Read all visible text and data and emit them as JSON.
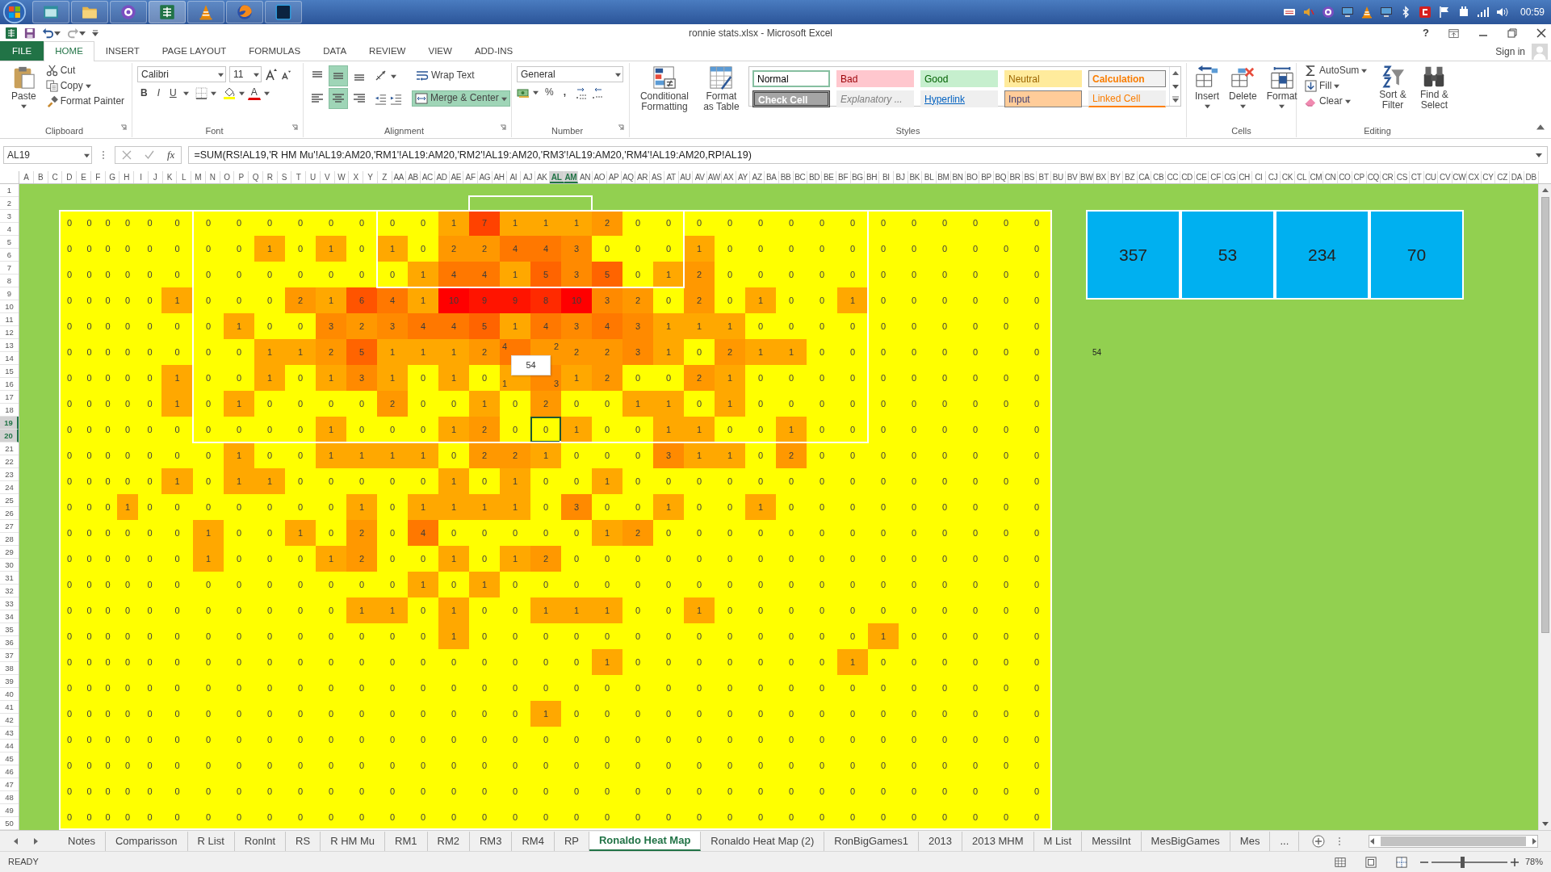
{
  "taskbar": {
    "clock": "00:59"
  },
  "window": {
    "title": "ronnie stats.xlsx - Microsoft Excel",
    "help": "?",
    "sign_in": "Sign in"
  },
  "ribbon_tabs": [
    {
      "label": "FILE",
      "kind": "file",
      "selected": false
    },
    {
      "label": "HOME",
      "kind": "tab",
      "selected": true
    },
    {
      "label": "INSERT",
      "kind": "tab",
      "selected": false
    },
    {
      "label": "PAGE LAYOUT",
      "kind": "tab",
      "selected": false
    },
    {
      "label": "FORMULAS",
      "kind": "tab",
      "selected": false
    },
    {
      "label": "DATA",
      "kind": "tab",
      "selected": false
    },
    {
      "label": "REVIEW",
      "kind": "tab",
      "selected": false
    },
    {
      "label": "VIEW",
      "kind": "tab",
      "selected": false
    },
    {
      "label": "ADD-INS",
      "kind": "tab",
      "selected": false
    }
  ],
  "clipboard": {
    "paste": "Paste",
    "cut": "Cut",
    "copy": "Copy",
    "format_painter": "Format Painter",
    "label": "Clipboard"
  },
  "font": {
    "name": "Calibri",
    "size": "11",
    "bold": "B",
    "italic": "I",
    "underline": "U",
    "font_color": "A",
    "label": "Font"
  },
  "alignment": {
    "align_buttons": [
      {
        "on": false
      },
      {
        "on": true
      },
      {
        "on": false
      },
      {
        "on": false
      },
      {
        "on": true
      },
      {
        "on": false
      }
    ],
    "wrap_text": "Wrap Text",
    "merge_center": {
      "label": "Merge & Center",
      "on": true
    },
    "label": "Alignment"
  },
  "number": {
    "format": "General",
    "percent": "%",
    "comma": ",",
    "label": "Number"
  },
  "styles": {
    "conditional": "Conditional Formatting",
    "format_table": "Format as Table",
    "gallery": [
      {
        "label": "Normal",
        "kind": "normal"
      },
      {
        "label": "Bad",
        "kind": "bad"
      },
      {
        "label": "Good",
        "kind": "good"
      },
      {
        "label": "Neutral",
        "kind": "neutral"
      },
      {
        "label": "Calculation",
        "kind": "calculation"
      },
      {
        "label": "Check Cell",
        "kind": "check"
      },
      {
        "label": "Explanatory ...",
        "kind": "explanatory"
      },
      {
        "label": "Hyperlink",
        "kind": "hyperlink"
      },
      {
        "label": "Input",
        "kind": "input"
      },
      {
        "label": "Linked Cell",
        "kind": "linked"
      }
    ],
    "label": "Styles"
  },
  "cells": {
    "insert": "Insert",
    "delete": "Delete",
    "format": "Format",
    "label": "Cells"
  },
  "editing": {
    "autosum": "AutoSum",
    "fill": "Fill",
    "clear": "Clear",
    "sort_filter": "Sort & Filter",
    "find_select": "Find & Select",
    "label": "Editing"
  },
  "formula_bar": {
    "name_box": "AL19",
    "fx": "fx",
    "formula": "=SUM(RS!AL19,'R HM Mu'!AL19:AM20,'RM1'!AL19:AM20,'RM2'!AL19:AM20,'RM3'!AL19:AM20,'RM4'!AL19:AM20,RP!AL19)"
  },
  "column_headers": [
    {
      "label": "A",
      "selected": false
    },
    {
      "label": "B",
      "selected": false
    },
    {
      "label": "C",
      "selected": false
    },
    {
      "label": "D",
      "selected": false
    },
    {
      "label": "E",
      "selected": false
    },
    {
      "label": "F",
      "selected": false
    },
    {
      "label": "G",
      "selected": false
    },
    {
      "label": "H",
      "selected": false
    },
    {
      "label": "I",
      "selected": false
    },
    {
      "label": "J",
      "selected": false
    },
    {
      "label": "K",
      "selected": false
    },
    {
      "label": "L",
      "selected": false
    },
    {
      "label": "M",
      "selected": false
    },
    {
      "label": "N",
      "selected": false
    },
    {
      "label": "O",
      "selected": false
    },
    {
      "label": "P",
      "selected": false
    },
    {
      "label": "Q",
      "selected": false
    },
    {
      "label": "R",
      "selected": false
    },
    {
      "label": "S",
      "selected": false
    },
    {
      "label": "T",
      "selected": false
    },
    {
      "label": "U",
      "selected": false
    },
    {
      "label": "V",
      "selected": false
    },
    {
      "label": "W",
      "selected": false
    },
    {
      "label": "X",
      "selected": false
    },
    {
      "label": "Y",
      "selected": false
    },
    {
      "label": "Z",
      "selected": false
    },
    {
      "label": "AA",
      "selected": false
    },
    {
      "label": "AB",
      "selected": false
    },
    {
      "label": "AC",
      "selected": false
    },
    {
      "label": "AD",
      "selected": false
    },
    {
      "label": "AE",
      "selected": false
    },
    {
      "label": "AF",
      "selected": false
    },
    {
      "label": "AG",
      "selected": false
    },
    {
      "label": "AH",
      "selected": false
    },
    {
      "label": "AI",
      "selected": false
    },
    {
      "label": "AJ",
      "selected": false
    },
    {
      "label": "AK",
      "selected": false
    },
    {
      "label": "AL",
      "selected": true
    },
    {
      "label": "AM",
      "selected": true
    },
    {
      "label": "AN",
      "selected": false
    },
    {
      "label": "AO",
      "selected": false
    },
    {
      "label": "AP",
      "selected": false
    },
    {
      "label": "AQ",
      "selected": false
    },
    {
      "label": "AR",
      "selected": false
    },
    {
      "label": "AS",
      "selected": false
    },
    {
      "label": "AT",
      "selected": false
    },
    {
      "label": "AU",
      "selected": false
    },
    {
      "label": "AV",
      "selected": false
    },
    {
      "label": "AW",
      "selected": false
    },
    {
      "label": "AX",
      "selected": false
    },
    {
      "label": "AY",
      "selected": false
    },
    {
      "label": "AZ",
      "selected": false
    },
    {
      "label": "BA",
      "selected": false
    },
    {
      "label": "BB",
      "selected": false
    },
    {
      "label": "BC",
      "selected": false
    },
    {
      "label": "BD",
      "selected": false
    },
    {
      "label": "BE",
      "selected": false
    },
    {
      "label": "BF",
      "selected": false
    },
    {
      "label": "BG",
      "selected": false
    },
    {
      "label": "BH",
      "selected": false
    },
    {
      "label": "BI",
      "selected": false
    },
    {
      "label": "BJ",
      "selected": false
    },
    {
      "label": "BK",
      "selected": false
    },
    {
      "label": "BL",
      "selected": false
    },
    {
      "label": "BM",
      "selected": false
    },
    {
      "label": "BN",
      "selected": false
    },
    {
      "label": "BO",
      "selected": false
    },
    {
      "label": "BP",
      "selected": false
    },
    {
      "label": "BQ",
      "selected": false
    },
    {
      "label": "BR",
      "selected": false
    },
    {
      "label": "BS",
      "selected": false
    },
    {
      "label": "BT",
      "selected": false
    },
    {
      "label": "BU",
      "selected": false
    },
    {
      "label": "BV",
      "selected": false
    },
    {
      "label": "BW",
      "selected": false
    },
    {
      "label": "BX",
      "selected": false
    },
    {
      "label": "BY",
      "selected": false
    },
    {
      "label": "BZ",
      "selected": false
    },
    {
      "label": "CA",
      "selected": false
    },
    {
      "label": "CB",
      "selected": false
    },
    {
      "label": "CC",
      "selected": false
    },
    {
      "label": "CD",
      "selected": false
    },
    {
      "label": "CE",
      "selected": false
    },
    {
      "label": "CF",
      "selected": false
    },
    {
      "label": "CG",
      "selected": false
    },
    {
      "label": "CH",
      "selected": false
    },
    {
      "label": "CI",
      "selected": false
    },
    {
      "label": "CJ",
      "selected": false
    },
    {
      "label": "CK",
      "selected": false
    },
    {
      "label": "CL",
      "selected": false
    },
    {
      "label": "CM",
      "selected": false
    },
    {
      "label": "CN",
      "selected": false
    },
    {
      "label": "CO",
      "selected": false
    },
    {
      "label": "CP",
      "selected": false
    },
    {
      "label": "CQ",
      "selected": false
    },
    {
      "label": "CR",
      "selected": false
    },
    {
      "label": "CS",
      "selected": false
    },
    {
      "label": "CT",
      "selected": false
    },
    {
      "label": "CU",
      "selected": false
    },
    {
      "label": "CV",
      "selected": false
    },
    {
      "label": "CW",
      "selected": false
    },
    {
      "label": "CX",
      "selected": false
    },
    {
      "label": "CY",
      "selected": false
    },
    {
      "label": "CZ",
      "selected": false
    },
    {
      "label": "DA",
      "selected": false
    },
    {
      "label": "DB",
      "selected": false
    }
  ],
  "row_headers": [
    {
      "label": "1",
      "selected": false
    },
    {
      "label": "2",
      "selected": false
    },
    {
      "label": "3",
      "selected": false
    },
    {
      "label": "4",
      "selected": false
    },
    {
      "label": "5",
      "selected": false
    },
    {
      "label": "6",
      "selected": false
    },
    {
      "label": "7",
      "selected": false
    },
    {
      "label": "8",
      "selected": false
    },
    {
      "label": "9",
      "selected": false
    },
    {
      "label": "10",
      "selected": false
    },
    {
      "label": "11",
      "selected": false
    },
    {
      "label": "12",
      "selected": false
    },
    {
      "label": "13",
      "selected": false
    },
    {
      "label": "14",
      "selected": false
    },
    {
      "label": "15",
      "selected": false
    },
    {
      "label": "16",
      "selected": false
    },
    {
      "label": "17",
      "selected": false
    },
    {
      "label": "18",
      "selected": false
    },
    {
      "label": "19",
      "selected": true
    },
    {
      "label": "20",
      "selected": true
    },
    {
      "label": "21",
      "selected": false
    },
    {
      "label": "22",
      "selected": false
    },
    {
      "label": "23",
      "selected": false
    },
    {
      "label": "24",
      "selected": false
    },
    {
      "label": "25",
      "selected": false
    },
    {
      "label": "26",
      "selected": false
    },
    {
      "label": "27",
      "selected": false
    },
    {
      "label": "28",
      "selected": false
    },
    {
      "label": "29",
      "selected": false
    },
    {
      "label": "30",
      "selected": false
    },
    {
      "label": "31",
      "selected": false
    },
    {
      "label": "32",
      "selected": false
    },
    {
      "label": "33",
      "selected": false
    },
    {
      "label": "34",
      "selected": false
    },
    {
      "label": "35",
      "selected": false
    },
    {
      "label": "36",
      "selected": false
    },
    {
      "label": "37",
      "selected": false
    },
    {
      "label": "38",
      "selected": false
    },
    {
      "label": "39",
      "selected": false
    },
    {
      "label": "40",
      "selected": false
    },
    {
      "label": "41",
      "selected": false
    },
    {
      "label": "42",
      "selected": false
    },
    {
      "label": "43",
      "selected": false
    },
    {
      "label": "44",
      "selected": false
    },
    {
      "label": "45",
      "selected": false
    },
    {
      "label": "46",
      "selected": false
    },
    {
      "label": "47",
      "selected": false
    },
    {
      "label": "48",
      "selected": false
    },
    {
      "label": "49",
      "selected": false
    },
    {
      "label": "50",
      "selected": false
    }
  ],
  "heatmap": {
    "rows": [
      [
        "0",
        "0",
        "0",
        "0",
        "0",
        "0",
        "0",
        "0",
        "0",
        "0",
        "0",
        "0",
        "0",
        "0",
        "1",
        "7",
        "1",
        "1",
        "1",
        "2",
        "0",
        "0",
        "0",
        "0",
        "0",
        "0",
        "0",
        "0",
        "0",
        "0",
        "0",
        "0",
        "0",
        "0"
      ],
      [
        "0",
        "0",
        "0",
        "0",
        "0",
        "0",
        "0",
        "0",
        "1",
        "0",
        "1",
        "0",
        "1",
        "0",
        "2",
        "2",
        "4",
        "4",
        "3",
        "0",
        "0",
        "0",
        "1",
        "0",
        "0",
        "0",
        "0",
        "0",
        "0",
        "0",
        "0",
        "0",
        "0",
        "0"
      ],
      [
        "0",
        "0",
        "0",
        "0",
        "0",
        "0",
        "0",
        "0",
        "0",
        "0",
        "0",
        "0",
        "0",
        "1",
        "4",
        "4",
        "1",
        "5",
        "3",
        "5",
        "0",
        "1",
        "2",
        "0",
        "0",
        "0",
        "0",
        "0",
        "0",
        "0",
        "0",
        "0",
        "0",
        "0"
      ],
      [
        "0",
        "0",
        "0",
        "0",
        "0",
        "1",
        "0",
        "0",
        "0",
        "2",
        "1",
        "6",
        "4",
        "1",
        "10",
        "9",
        "9",
        "8",
        "10",
        "3",
        "2",
        "0",
        "2",
        "0",
        "1",
        "0",
        "0",
        "1",
        "0",
        "0",
        "0",
        "0",
        "0",
        "0"
      ],
      [
        "0",
        "0",
        "0",
        "0",
        "0",
        "0",
        "0",
        "1",
        "0",
        "0",
        "3",
        "2",
        "3",
        "4",
        "4",
        "5",
        "1",
        "4",
        "3",
        "4",
        "3",
        "1",
        "1",
        "1",
        "0",
        "0",
        "0",
        "0",
        "0",
        "0",
        "0",
        "0",
        "0",
        "0"
      ],
      [
        "0",
        "0",
        "0",
        "0",
        "0",
        "0",
        "0",
        "0",
        "1",
        "1",
        "2",
        "5",
        "1",
        "1",
        "1",
        "2",
        {
          "text": "4",
          "kind": "covered"
        },
        {
          "text": "2",
          "kind": "covered"
        },
        "2",
        "2",
        "3",
        "1",
        "0",
        "2",
        "1",
        "1",
        "0",
        "0",
        "0",
        "0",
        "0",
        "0",
        "0",
        "0"
      ],
      [
        "0",
        "0",
        "0",
        "0",
        "0",
        "1",
        "0",
        "0",
        "1",
        "0",
        "1",
        "3",
        "1",
        "0",
        "1",
        "0",
        {
          "text": "1",
          "kind": "covered"
        },
        {
          "text": "3",
          "kind": "covered"
        },
        "1",
        "2",
        "0",
        "0",
        "2",
        "1",
        "0",
        "0",
        "0",
        "0",
        "0",
        "0",
        "0",
        "0",
        "0",
        "0"
      ],
      [
        "0",
        "0",
        "0",
        "0",
        "0",
        "1",
        "0",
        "1",
        "0",
        "0",
        "0",
        "0",
        "2",
        "0",
        "0",
        "1",
        "0",
        "2",
        "0",
        "0",
        "1",
        "1",
        "0",
        "1",
        "0",
        "0",
        "0",
        "0",
        "0",
        "0",
        "0",
        "0",
        "0",
        "0"
      ],
      [
        "0",
        "0",
        "0",
        "0",
        "0",
        "0",
        "0",
        "0",
        "0",
        "0",
        "1",
        "0",
        "0",
        "0",
        "1",
        "2",
        "0",
        {
          "text": "0",
          "kind": "active"
        },
        "1",
        "0",
        "0",
        "1",
        "1",
        "0",
        "0",
        "1",
        "0",
        "0",
        "0",
        "0",
        "0",
        "0",
        "0",
        "0"
      ],
      [
        "0",
        "0",
        "0",
        "0",
        "0",
        "0",
        "0",
        "1",
        "0",
        "0",
        "1",
        "1",
        "1",
        "1",
        "0",
        "2",
        "2",
        "1",
        "0",
        "0",
        "0",
        "3",
        "1",
        "1",
        "0",
        "2",
        "0",
        "0",
        "0",
        "0",
        "0",
        "0",
        "0",
        "0"
      ],
      [
        "0",
        "0",
        "0",
        "0",
        "0",
        "1",
        "0",
        "1",
        "1",
        "0",
        "0",
        "0",
        "0",
        "0",
        "1",
        "0",
        "1",
        "0",
        "0",
        "1",
        "0",
        "0",
        "0",
        "0",
        "0",
        "0",
        "0",
        "0",
        "0",
        "0",
        "0",
        "0",
        "0",
        "0"
      ],
      [
        "0",
        "0",
        "0",
        "1",
        "0",
        "0",
        "0",
        "0",
        "0",
        "0",
        "0",
        "1",
        "0",
        "1",
        "1",
        "1",
        "1",
        "0",
        "3",
        "0",
        "0",
        "1",
        "0",
        "0",
        "1",
        "0",
        "0",
        "0",
        "0",
        "0",
        "0",
        "0",
        "0",
        "0"
      ],
      [
        "0",
        "0",
        "0",
        "0",
        "0",
        "0",
        "1",
        "0",
        "0",
        "1",
        "0",
        "2",
        "0",
        "4",
        "0",
        "0",
        "0",
        "0",
        "0",
        "1",
        "2",
        "0",
        "0",
        "0",
        "0",
        "0",
        "0",
        "0",
        "0",
        "0",
        "0",
        "0",
        "0",
        "0"
      ],
      [
        "0",
        "0",
        "0",
        "0",
        "0",
        "0",
        "1",
        "0",
        "0",
        "0",
        "1",
        "2",
        "0",
        "0",
        "1",
        "0",
        "1",
        "2",
        "0",
        "0",
        "0",
        "0",
        "0",
        "0",
        "0",
        "0",
        "0",
        "0",
        "0",
        "0",
        "0",
        "0",
        "0",
        "0"
      ],
      [
        "0",
        "0",
        "0",
        "0",
        "0",
        "0",
        "0",
        "0",
        "0",
        "0",
        "0",
        "0",
        "0",
        "1",
        "0",
        "1",
        "0",
        "0",
        "0",
        "0",
        "0",
        "0",
        "0",
        "0",
        "0",
        "0",
        "0",
        "0",
        "0",
        "0",
        "0",
        "0",
        "0",
        "0"
      ],
      [
        "0",
        "0",
        "0",
        "0",
        "0",
        "0",
        "0",
        "0",
        "0",
        "0",
        "0",
        "1",
        "1",
        "0",
        "1",
        "0",
        "0",
        "1",
        "1",
        "1",
        "0",
        "0",
        "1",
        "0",
        "0",
        "0",
        "0",
        "0",
        "0",
        "0",
        "0",
        "0",
        "0",
        "0"
      ],
      [
        "0",
        "0",
        "0",
        "0",
        "0",
        "0",
        "0",
        "0",
        "0",
        "0",
        "0",
        "0",
        "0",
        "0",
        "1",
        "0",
        "0",
        "0",
        "0",
        "0",
        "0",
        "0",
        "0",
        "0",
        "0",
        "0",
        "0",
        "0",
        "1",
        "0",
        "0",
        "0",
        "0",
        "0"
      ],
      [
        "0",
        "0",
        "0",
        "0",
        "0",
        "0",
        "0",
        "0",
        "0",
        "0",
        "0",
        "0",
        "0",
        "0",
        "0",
        "0",
        "0",
        "0",
        "0",
        "1",
        "0",
        "0",
        "0",
        "0",
        "0",
        "0",
        "0",
        "1",
        "0",
        "0",
        "0",
        "0",
        "0",
        "0"
      ],
      [
        "0",
        "0",
        "0",
        "0",
        "0",
        "0",
        "0",
        "0",
        "0",
        "0",
        "0",
        "0",
        "0",
        "0",
        "0",
        "0",
        "0",
        "0",
        "0",
        "0",
        "0",
        "0",
        "0",
        "0",
        "0",
        "0",
        "0",
        "0",
        "0",
        "0",
        "0",
        "0",
        "0",
        "0"
      ],
      [
        "0",
        "0",
        "0",
        "0",
        "0",
        "0",
        "0",
        "0",
        "0",
        "0",
        "0",
        "0",
        "0",
        "0",
        "0",
        "0",
        "0",
        "1",
        "0",
        "0",
        "0",
        "0",
        "0",
        "0",
        "0",
        "0",
        "0",
        "0",
        "0",
        "0",
        "0",
        "0",
        "0",
        "0"
      ],
      [
        "0",
        "0",
        "0",
        "0",
        "0",
        "0",
        "0",
        "0",
        "0",
        "0",
        "0",
        "0",
        "0",
        "0",
        "0",
        "0",
        "0",
        "0",
        "0",
        "0",
        "0",
        "0",
        "0",
        "0",
        "0",
        "0",
        "0",
        "0",
        "0",
        "0",
        "0",
        "0",
        "0",
        "0"
      ],
      [
        "0",
        "0",
        "0",
        "0",
        "0",
        "0",
        "0",
        "0",
        "0",
        "0",
        "0",
        "0",
        "0",
        "0",
        "0",
        "0",
        "0",
        "0",
        "0",
        "0",
        "0",
        "0",
        "0",
        "0",
        "0",
        "0",
        "0",
        "0",
        "0",
        "0",
        "0",
        "0",
        "0",
        "0"
      ],
      [
        "0",
        "0",
        "0",
        "0",
        "0",
        "0",
        "0",
        "0",
        "0",
        "0",
        "0",
        "0",
        "0",
        "0",
        "0",
        "0",
        "0",
        "0",
        "0",
        "0",
        "0",
        "0",
        "0",
        "0",
        "0",
        "0",
        "0",
        "0",
        "0",
        "0",
        "0",
        "0",
        "0",
        "0"
      ],
      [
        "0",
        "0",
        "0",
        "0",
        "0",
        "0",
        "0",
        "0",
        "0",
        "0",
        "0",
        "0",
        "0",
        "0",
        "0",
        "0",
        "0",
        "0",
        "0",
        "0",
        "0",
        "0",
        "0",
        "0",
        "0",
        "0",
        "0",
        "0",
        "0",
        "0",
        "0",
        "0",
        "0",
        "0"
      ]
    ],
    "comment_box": "54"
  },
  "summary_boxes": [
    "357",
    "53",
    "234",
    "70"
  ],
  "side_value": "54",
  "sheet_tabs": [
    {
      "label": "Notes",
      "selected": false
    },
    {
      "label": "Comparisson",
      "selected": false
    },
    {
      "label": "R List",
      "selected": false
    },
    {
      "label": "RonInt",
      "selected": false
    },
    {
      "label": "RS",
      "selected": false
    },
    {
      "label": "R HM Mu",
      "selected": false
    },
    {
      "label": "RM1",
      "selected": false
    },
    {
      "label": "RM2",
      "selected": false
    },
    {
      "label": "RM3",
      "selected": false
    },
    {
      "label": "RM4",
      "selected": false
    },
    {
      "label": "RP",
      "selected": false
    },
    {
      "label": "Ronaldo Heat Map",
      "selected": true
    },
    {
      "label": "Ronaldo Heat Map (2)",
      "selected": false
    },
    {
      "label": "RonBigGames1",
      "selected": false
    },
    {
      "label": "2013",
      "selected": false
    },
    {
      "label": "2013 MHM",
      "selected": false
    },
    {
      "label": "M List",
      "selected": false
    },
    {
      "label": "MessiInt",
      "selected": false
    },
    {
      "label": "MesBigGames",
      "selected": false
    },
    {
      "label": "Mes",
      "selected": false
    }
  ],
  "more_tabs": "...",
  "status_bar": {
    "text": "READY",
    "zoom": "78%",
    "zoom_slider": {
      "level": 0.41
    }
  }
}
